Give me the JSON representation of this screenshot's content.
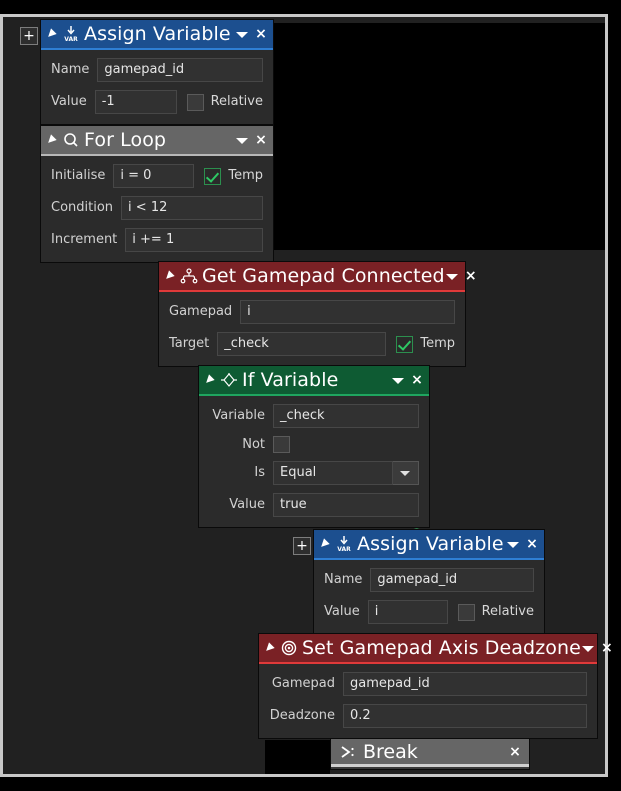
{
  "canvas": {
    "background_color": "#212121",
    "frame_color": "#c8c8c8",
    "outside_color": "#000000"
  },
  "nodes": [
    {
      "id": "assign-variable-1",
      "title": "Assign Variable",
      "icon": "assign-var-icon",
      "header_color": "#1c4f8f",
      "accent_color": "#2f7fd4",
      "has_plus_button": true,
      "plus_label": "+",
      "caret": "chevron-down-icon",
      "close": "×",
      "rows": [
        {
          "label": "Name",
          "value": "gamepad_id",
          "type": "text"
        },
        {
          "label": "Value",
          "value": "-1",
          "type": "text",
          "checkbox_label": "Relative",
          "checked": false
        }
      ]
    },
    {
      "id": "for-loop",
      "title": "For Loop",
      "icon": "loop-icon",
      "header_color": "#666666",
      "accent_color": "#b8b8b8",
      "has_plus_button": false,
      "caret": "chevron-down-icon",
      "close": "×",
      "rows": [
        {
          "label": "Initialise",
          "value": "i = 0",
          "type": "text",
          "checkbox_label": "Temp",
          "checked": true
        },
        {
          "label": "Condition",
          "value": "i < 12",
          "type": "text"
        },
        {
          "label": "Increment",
          "value": "i += 1",
          "type": "text"
        }
      ]
    },
    {
      "id": "get-gamepad-connected",
      "title": "Get Gamepad Connected",
      "icon": "gamepad-icon",
      "header_color": "#7a2125",
      "accent_color": "#e03a3a",
      "has_plus_button": false,
      "caret": "chevron-down-icon",
      "close": "×",
      "rows": [
        {
          "label": "Gamepad",
          "value": "i",
          "type": "text"
        },
        {
          "label": "Target",
          "value": "_check",
          "type": "text",
          "checkbox_label": "Temp",
          "checked": true
        }
      ]
    },
    {
      "id": "if-variable",
      "title": "If Variable",
      "icon": "branch-icon",
      "header_color": "#0e5b33",
      "accent_color": "#1fa55f",
      "has_plus_button": false,
      "caret": "chevron-down-icon",
      "close": "×",
      "rows": [
        {
          "label": "Variable",
          "value": "_check",
          "type": "text"
        },
        {
          "label": "Not",
          "value": "",
          "type": "checkbox-only",
          "checked": false
        },
        {
          "label": "Is",
          "value": "Equal",
          "type": "dropdown",
          "options": [
            "Equal"
          ]
        },
        {
          "label": "Value",
          "value": "true",
          "type": "text"
        }
      ]
    },
    {
      "id": "assign-variable-2",
      "title": "Assign Variable",
      "icon": "assign-var-icon",
      "header_color": "#1c4f8f",
      "accent_color": "#2f7fd4",
      "has_plus_button": true,
      "plus_label": "+",
      "caret": "chevron-down-icon",
      "close": "×",
      "rows": [
        {
          "label": "Name",
          "value": "gamepad_id",
          "type": "text"
        },
        {
          "label": "Value",
          "value": "i",
          "type": "text",
          "checkbox_label": "Relative",
          "checked": false
        }
      ]
    },
    {
      "id": "set-gamepad-axis-deadzone",
      "title": "Set Gamepad Axis Deadzone",
      "icon": "target-icon",
      "header_color": "#7a2125",
      "accent_color": "#e03a3a",
      "has_plus_button": false,
      "caret": "chevron-down-icon",
      "close": "×",
      "rows": [
        {
          "label": "Gamepad",
          "value": "gamepad_id",
          "type": "text"
        },
        {
          "label": "Deadzone",
          "value": "0.2",
          "type": "text"
        }
      ]
    },
    {
      "id": "break",
      "title": "Break",
      "icon": "break-icon",
      "header_color": "#666666",
      "accent_color": "#d0d0d0",
      "has_plus_button": false,
      "close": "×",
      "rows": []
    }
  ],
  "connectors": [
    {
      "from": "assign-variable-1",
      "to": "for-loop",
      "color": "#cfcfcf"
    },
    {
      "from": "for-loop",
      "to": "get-gamepad-connected",
      "color": "#cfcfcf"
    },
    {
      "from": "get-gamepad-connected",
      "to": "if-variable",
      "color": "#cfcfcf"
    },
    {
      "from": "if-variable",
      "to": "assign-variable-2",
      "color": "#2f7a4a"
    },
    {
      "from": "assign-variable-2",
      "to": "set-gamepad-axis-deadzone",
      "color": "#2f7a4a"
    },
    {
      "from": "set-gamepad-axis-deadzone",
      "to": "break",
      "color": "#2f7a4a"
    }
  ]
}
